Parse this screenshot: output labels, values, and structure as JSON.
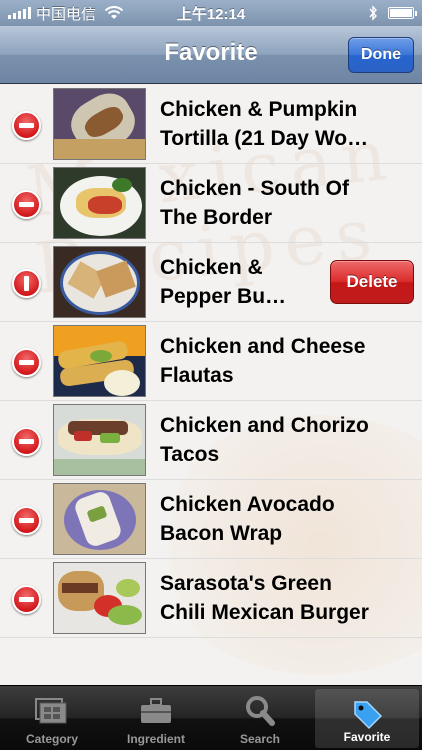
{
  "status_bar": {
    "carrier": "中国电信",
    "time": "上午12:14"
  },
  "nav": {
    "title": "Favorite",
    "done_label": "Done"
  },
  "recipes": [
    {
      "title": "Chicken & Pumpkin\nTortilla (21 Day Wo…",
      "control": "minus"
    },
    {
      "title": "Chicken - South Of\nThe Border",
      "control": "minus"
    },
    {
      "title": "Chicken &\nPepper Bu…",
      "control": "minus-rotated",
      "delete_label": "Delete"
    },
    {
      "title": "Chicken and Cheese\nFlautas",
      "control": "minus"
    },
    {
      "title": "Chicken and Chorizo\nTacos",
      "control": "minus"
    },
    {
      "title": "Chicken Avocado\nBacon Wrap",
      "control": "minus"
    },
    {
      "title": "Sarasota's Green\nChili Mexican Burger",
      "control": "minus"
    }
  ],
  "tabs": [
    {
      "label": "Category",
      "icon": "category-icon",
      "selected": false
    },
    {
      "label": "Ingredient",
      "icon": "briefcase-icon",
      "selected": false
    },
    {
      "label": "Search",
      "icon": "search-icon",
      "selected": false
    },
    {
      "label": "Favorite",
      "icon": "tag-icon",
      "selected": true
    }
  ],
  "colors": {
    "nav_bar": "#7b92ae",
    "done_button": "#2a62c4",
    "delete_button": "#c41818",
    "tab_bar": "#111111"
  }
}
